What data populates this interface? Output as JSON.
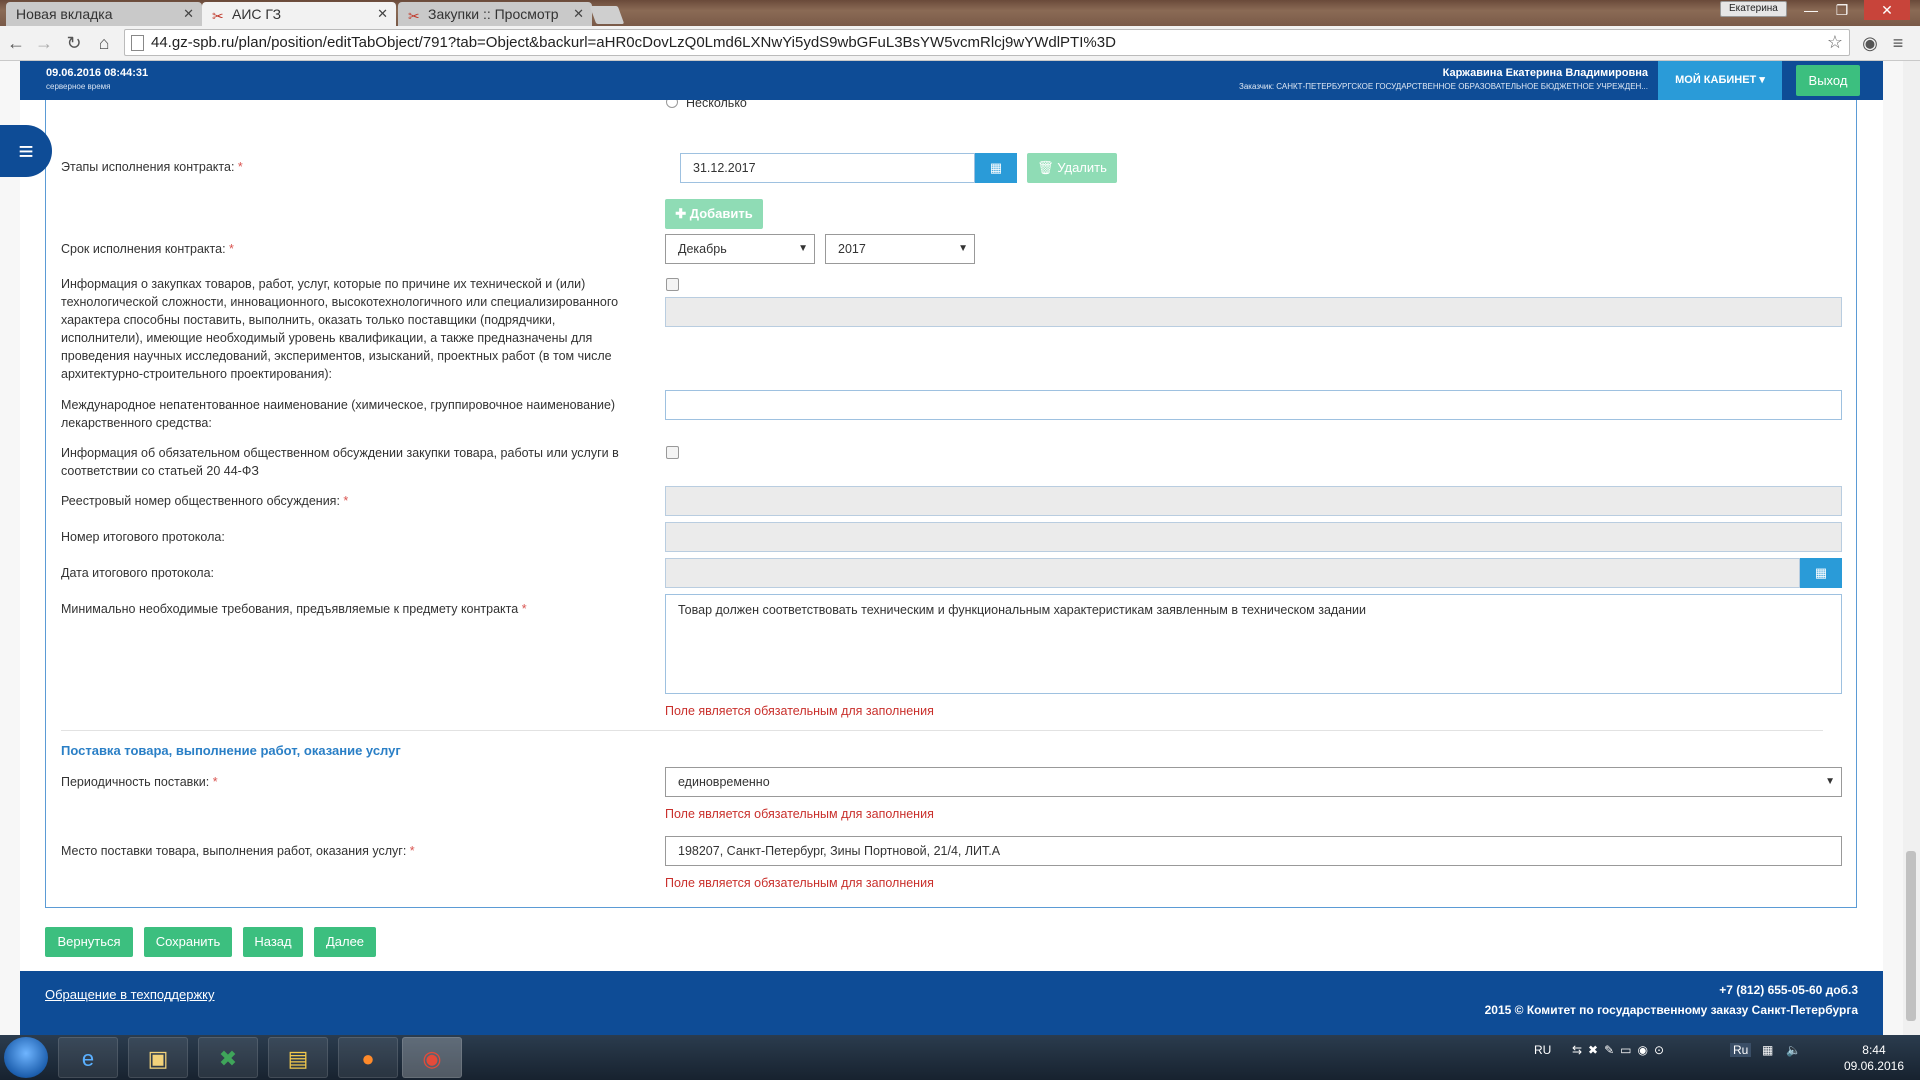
{
  "browser": {
    "tabs": [
      {
        "label": "Новая вкладка"
      },
      {
        "label": "АИС ГЗ"
      },
      {
        "label": "Закупки :: Просмотр"
      }
    ],
    "user_chip": "Екатерина",
    "url": "44.gz-spb.ru/plan/position/editTabObject/791?tab=Object&backurl=aHR0cDovLzQ0Lmd6LXNwYi5ydS9wbGFuL3BsYW5vcmRlcj9wYWdlPTI%3D"
  },
  "header": {
    "date": "09.06.2016 08:44:31",
    "date_sub": "серверное время",
    "user": "Каржавина Екатерина Владимировна",
    "customer": "Заказчик: САНКТ-ПЕТЕРБУРГСКОЕ ГОСУДАРСТВЕННОЕ ОБРАЗОВАТЕЛЬНОЕ БЮДЖЕТНОЕ УЧРЕЖДЕН...",
    "cabinet": "МОЙ КАБИНЕТ",
    "logout": "Выход"
  },
  "form": {
    "radio_partial": "Несколько",
    "stages_label": "Этапы исполнения контракта:",
    "stage_date": "31.12.2017",
    "delete_btn": "Удалить",
    "add_btn": "Добавить",
    "term_label": "Срок исполнения контракта:",
    "term_month": "Декабрь",
    "term_year": "2017",
    "tech_info_label": "Информация о закупках товаров, работ, услуг, которые по причине их технической и (или) технологической сложности, инновационного, высокотехнологичного или специализированного характера способны поставить, выполнить, оказать только поставщики (подрядчики, исполнители), имеющие необходимый уровень квалификации, а также предназначены для проведения научных исследований, экспериментов, изысканий, проектных работ (в том числе архитектурно-строительного проектирования):",
    "inn_label": "Международное непатентованное наименование (химическое, группировочное наименование) лекарственного средства:",
    "public_discussion_label": "Информация об обязательном общественном обсуждении закупки товара, работы или услуги в соответствии со статьей 20 44-ФЗ",
    "registry_label": "Реестровый номер общественного обсуждения:",
    "protocol_no_label": "Номер итогового протокола:",
    "protocol_date_label": "Дата итогового протокола:",
    "requirements_label": "Минимально необходимые требования, предъявляемые к предмету контракта",
    "requirements_value": "Товар должен соответствовать техническим и функциональным характеристикам заявленным в техническом задании",
    "required_error": "Поле является обязательным для заполнения",
    "delivery_section": "Поставка товара, выполнение работ, оказание услуг",
    "periodicity_label": "Периодичность поставки:",
    "periodicity_value": "единовременно",
    "place_label": "Место поставки товара, выполнения работ, оказания услуг:",
    "place_value": "198207, Санкт-Петербург, Зины Портновой, 21/4, ЛИТ.А",
    "required_mark": "*"
  },
  "actions": {
    "back": "Вернуться",
    "save": "Сохранить",
    "prev": "Назад",
    "next": "Далее"
  },
  "footer": {
    "support": "Обращение в техподдержку",
    "phone": "+7 (812) 655-05-60 доб.3",
    "copyright": "2015 © Комитет по государственному заказу Санкт-Петербурга"
  },
  "taskbar": {
    "lang": "RU",
    "kb": "Ru",
    "time": "8:44",
    "date": "09.06.2016"
  },
  "colors": {
    "header_blue": "#0e4c96",
    "green": "#3cbf7f",
    "accent_blue": "#2a9bd8",
    "error_red": "#c9302c"
  }
}
